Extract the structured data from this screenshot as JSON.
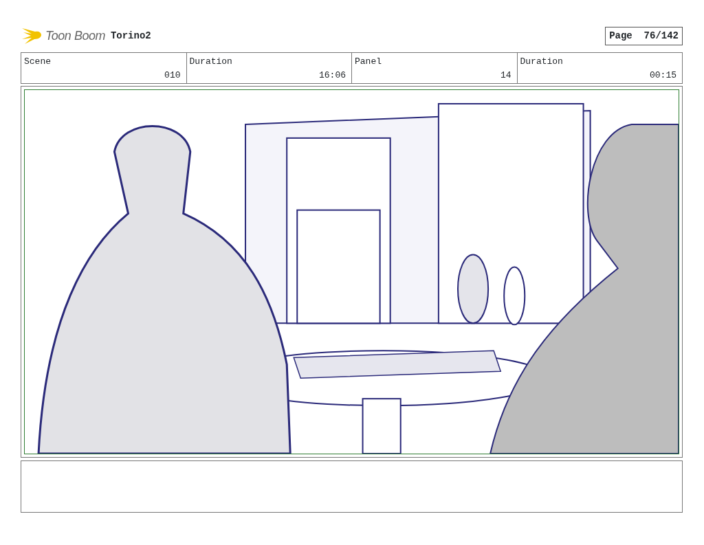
{
  "header": {
    "logo": "Toon Boom",
    "project": "Torino2",
    "page_label": "Page",
    "page_number": "76/142"
  },
  "fields": [
    {
      "label": "Scene",
      "value": "010"
    },
    {
      "label": "Duration",
      "value": "16:06"
    },
    {
      "label": "Panel",
      "value": "14"
    },
    {
      "label": "Duration",
      "value": "00:15"
    }
  ],
  "panel": {
    "image": {
      "kind": "room-picture"
    }
  }
}
